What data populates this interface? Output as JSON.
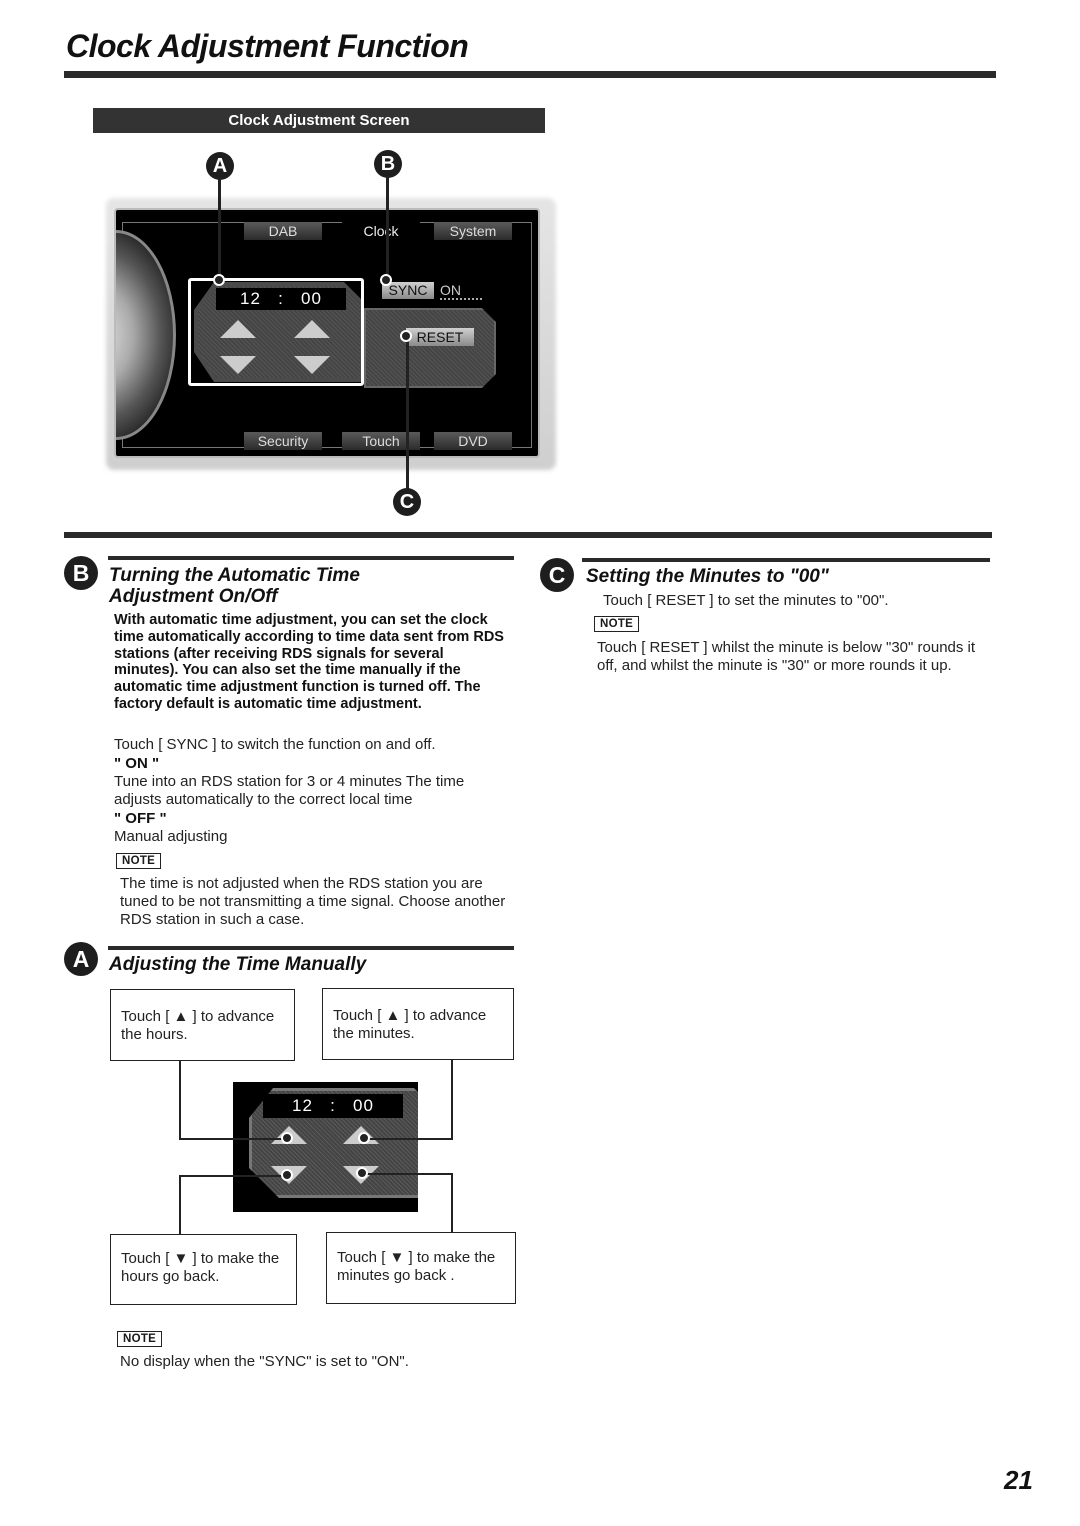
{
  "page": {
    "title": "Clock Adjustment Function",
    "page_number": "21"
  },
  "figure": {
    "label": "Clock Adjustment Screen",
    "callouts": {
      "a": "A",
      "b": "B",
      "c": "C"
    },
    "screen": {
      "top_tabs": [
        "DAB",
        "Clock",
        "System"
      ],
      "bottom_tabs": [
        "Security",
        "Touch",
        "DVD"
      ],
      "active_tab": "Clock",
      "clock_hours": "12",
      "clock_separator": ":",
      "clock_minutes": "00",
      "sync_label": "SYNC",
      "sync_value": "ON",
      "reset_label": "RESET"
    }
  },
  "section_b": {
    "badge": "B",
    "title_line1": "Turning the Automatic Time",
    "title_line2": "Adjustment On/Off",
    "intro": "With automatic time adjustment, you can set the clock time automatically according to time data sent from RDS stations (after receiving RDS signals for several minutes). You can also set the time manually if the automatic time adjustment function is turned off. The factory default is automatic time adjustment.",
    "instruction": "Touch [ SYNC ] to switch the function on and off.",
    "on_label": "\" ON \"",
    "on_text": "Tune into an RDS station for 3 or 4 minutes  The time adjusts automatically to the correct local time",
    "off_label": "\" OFF \"",
    "off_text": "Manual adjusting",
    "note_label": "NOTE",
    "note_text": "The time is not adjusted when the RDS station you are tuned to be not transmitting a time signal. Choose another RDS station in such a case."
  },
  "section_c": {
    "badge": "C",
    "title": "Setting the Minutes to \"00\"",
    "instruction": "Touch [ RESET ] to set the minutes to \"00\".",
    "note_label": "NOTE",
    "note_text": "Touch [ RESET ] whilst the minute is below \"30\" rounds it off, and whilst the minute is \"30\" or more rounds it up."
  },
  "section_a": {
    "badge": "A",
    "title": "Adjusting the Time Manually",
    "box_hours_up": "Touch [ ▲ ] to advance the hours.",
    "box_minutes_up": "Touch [ ▲ ] to advance the minutes.",
    "box_hours_down": "Touch [ ▼ ] to make the hours go back.",
    "box_minutes_down": "Touch [ ▼ ] to make the minutes go back .",
    "mini_hours": "12",
    "mini_separator": ":",
    "mini_minutes": "00",
    "note_label": "NOTE",
    "note_text": "No display when the \"SYNC\" is set to \"ON\"."
  }
}
